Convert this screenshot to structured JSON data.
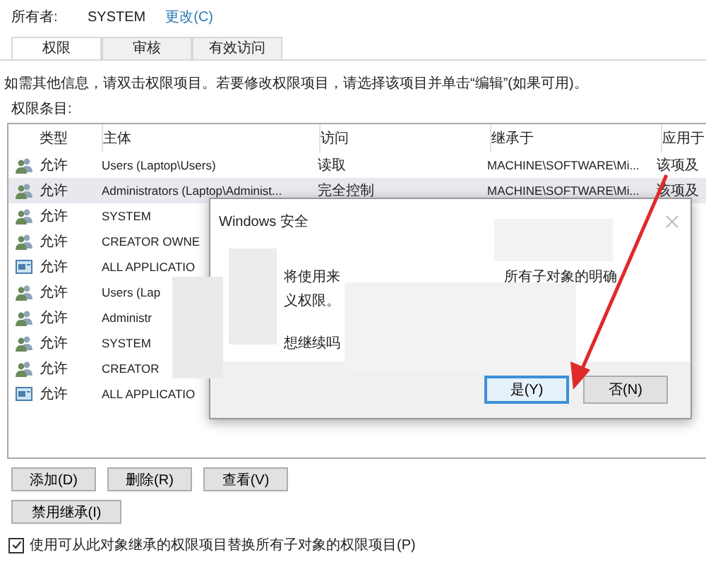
{
  "owner": {
    "label": "所有者:",
    "value": "SYSTEM",
    "link": "更改(C)"
  },
  "tabs": [
    {
      "label": "权限",
      "selected": true
    },
    {
      "label": "审核",
      "selected": false
    },
    {
      "label": "有效访问",
      "selected": false
    }
  ],
  "info": "如需其他信息，请双击权限项目。若要修改权限项目，请选择该项目并单击“编辑”(如果可用)。",
  "entries_label": "权限条目:",
  "table": {
    "columns": [
      "类型",
      "主体",
      "访问",
      "继承于",
      "应用于"
    ],
    "rows": [
      {
        "kind": "group",
        "type": "允许",
        "principal": "Users (Laptop\\Users)",
        "access": "读取",
        "inherited": "MACHINE\\SOFTWARE\\Mi...",
        "applies": "该项及",
        "selected": false
      },
      {
        "kind": "group",
        "type": "允许",
        "principal": "Administrators (Laptop\\Administ...",
        "access": "完全控制",
        "inherited": "MACHINE\\SOFTWARE\\Mi...",
        "applies": "该项及",
        "selected": true
      },
      {
        "kind": "group",
        "type": "允许",
        "principal": "SYSTEM",
        "selected": false
      },
      {
        "kind": "group",
        "type": "允许",
        "principal": "CREATOR OWNE",
        "selected": false
      },
      {
        "kind": "package",
        "type": "允许",
        "principal": "ALL APPLICATIO",
        "selected": false
      },
      {
        "kind": "group",
        "type": "允许",
        "principal": "Users (Lap",
        "selected": false
      },
      {
        "kind": "group",
        "type": "允许",
        "principal": "Administr",
        "selected": false
      },
      {
        "kind": "group",
        "type": "允许",
        "principal": "SYSTEM",
        "selected": false
      },
      {
        "kind": "group",
        "type": "允许",
        "principal": "CREATOR",
        "selected": false
      },
      {
        "kind": "package",
        "type": "允许",
        "principal": "ALL APPLICATIO",
        "selected": false
      }
    ]
  },
  "buttons": [
    "添加(D)",
    "删除(R)",
    "查看(V)"
  ],
  "disable_button": "禁用继承(I)",
  "replace_checkbox": {
    "label": "使用可从此对象继承的权限项目替换所有子对象的权限项目(P)",
    "checked": true
  },
  "dialog": {
    "title": "Windows 安全",
    "lines": [
      "将使用来",
      "所有子对象的明确",
      "义权限。",
      "想继续吗"
    ],
    "buttons": [
      {
        "label": "是(Y)",
        "selected": true
      },
      {
        "label": "否(N)",
        "selected": false
      }
    ]
  }
}
